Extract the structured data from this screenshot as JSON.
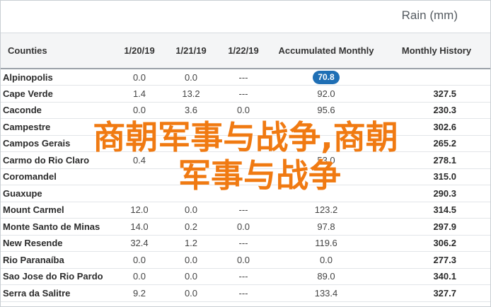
{
  "table": {
    "caption": "Rain (mm)",
    "headers": [
      "Counties",
      "1/20/19",
      "1/21/19",
      "1/22/19",
      "Accumulated Monthly",
      "Monthly History"
    ],
    "rows": [
      {
        "county": "Alpinopolis",
        "d1": "0.0",
        "d2": "0.0",
        "d3": "---",
        "acc": "70.8",
        "hist": ""
      },
      {
        "county": "Cape Verde",
        "d1": "1.4",
        "d2": "13.2",
        "d3": "---",
        "acc": "92.0",
        "hist": "327.5"
      },
      {
        "county": "Caconde",
        "d1": "0.0",
        "d2": "3.6",
        "d3": "0.0",
        "acc": "95.6",
        "hist": "230.3"
      },
      {
        "county": "Campestre",
        "d1": "",
        "d2": "",
        "d3": "",
        "acc": "",
        "hist": "302.6"
      },
      {
        "county": "Campos Gerais",
        "d1": "",
        "d2": "",
        "d3": "",
        "acc": "",
        "hist": "265.2"
      },
      {
        "county": "Carmo do Rio Claro",
        "d1": "0.4",
        "d2": "",
        "d3": "",
        "acc": "53.0",
        "hist": "278.1"
      },
      {
        "county": "Coromandel",
        "d1": "",
        "d2": "",
        "d3": "",
        "acc": "",
        "hist": "315.0"
      },
      {
        "county": "Guaxupe",
        "d1": "",
        "d2": "",
        "d3": "",
        "acc": "",
        "hist": "290.3"
      },
      {
        "county": "Mount Carmel",
        "d1": "12.0",
        "d2": "0.0",
        "d3": "---",
        "acc": "123.2",
        "hist": "314.5"
      },
      {
        "county": "Monte Santo de Minas",
        "d1": "14.0",
        "d2": "0.2",
        "d3": "0.0",
        "acc": "97.8",
        "hist": "297.9"
      },
      {
        "county": "New Resende",
        "d1": "32.4",
        "d2": "1.2",
        "d3": "---",
        "acc": "119.6",
        "hist": "306.2"
      },
      {
        "county": "Rio Paranaíba",
        "d1": "0.0",
        "d2": "0.0",
        "d3": "0.0",
        "acc": "0.0",
        "hist": "277.3"
      },
      {
        "county": "Sao Jose do Rio Pardo",
        "d1": "0.0",
        "d2": "0.0",
        "d3": "---",
        "acc": "89.0",
        "hist": "340.1"
      },
      {
        "county": "Serra da Salitre",
        "d1": "9.2",
        "d2": "0.0",
        "d3": "---",
        "acc": "133.4",
        "hist": "327.7"
      }
    ]
  },
  "watermark": {
    "line1": "商朝军事与战争,商朝",
    "line2": "军事与战争"
  },
  "colors": {
    "accent": "#1f6fb5",
    "watermark": "#f07a12"
  }
}
